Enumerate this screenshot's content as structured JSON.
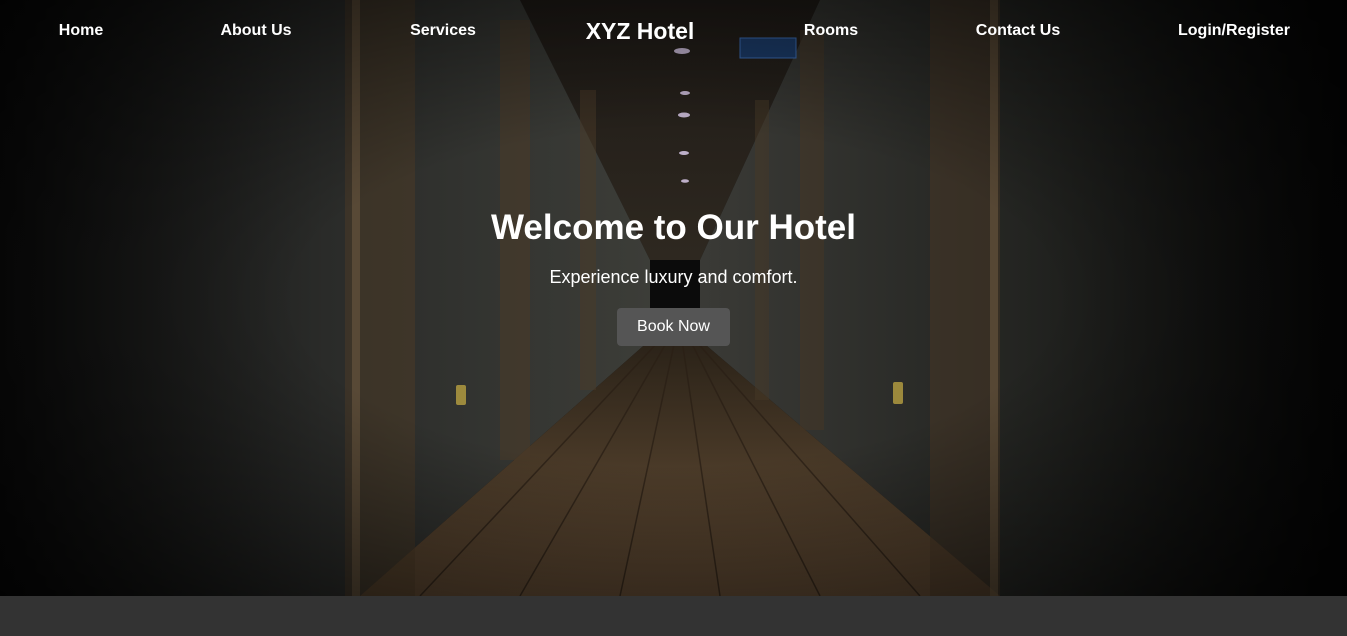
{
  "nav": {
    "home": "Home",
    "about": "About Us",
    "services": "Services",
    "brand": "XYZ Hotel",
    "rooms": "Rooms",
    "contact": "Contact Us",
    "login": "Login/Register"
  },
  "hero": {
    "title": "Welcome to Our Hotel",
    "subtitle": "Experience luxury and comfort.",
    "cta": "Book Now"
  },
  "colors": {
    "text": "#ffffff",
    "button_bg": "#555555",
    "footer_bg": "#333333"
  }
}
